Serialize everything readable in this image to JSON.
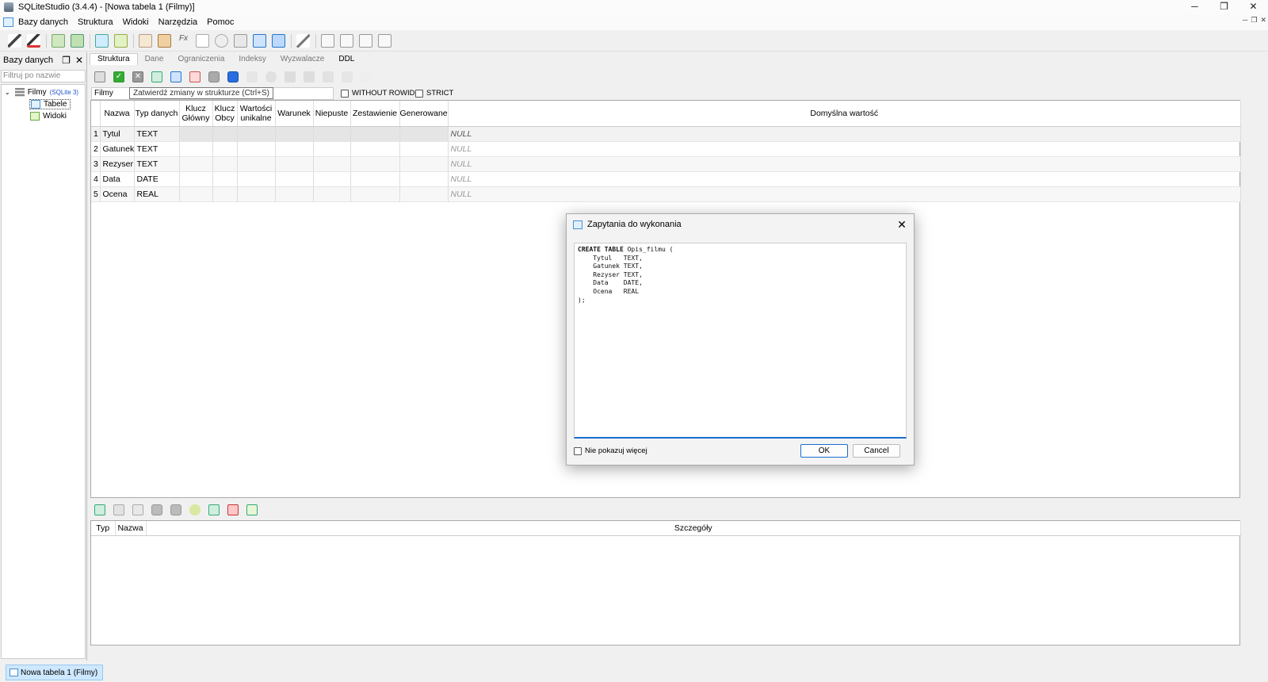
{
  "window": {
    "title": "SQLiteStudio (3.4.4) - [Nowa tabela 1 (Filmy)]",
    "minimize": "─",
    "maximize": "❐",
    "close": "✕"
  },
  "menu": [
    "Bazy danych",
    "Struktura",
    "Widoki",
    "Narzędzia",
    "Pomoc"
  ],
  "db_panel": {
    "title": "Bazy danych",
    "filter_placeholder": "Filtruj po nazwie",
    "db_name": "Filmy",
    "db_tag": "(SQLite 3)",
    "tree_items": [
      "Tabele",
      "Widoki"
    ]
  },
  "editor": {
    "tabs": [
      "Struktura",
      "Dane",
      "Ograniczenia",
      "Indeksy",
      "Wyzwalacze",
      "DDL"
    ],
    "table_name": "Filmy",
    "tooltip": "Zatwierdź zmiany w strukturze (Ctrl+S)",
    "without_rowid": "WITHOUT ROWID",
    "strict": "STRICT",
    "columns": {
      "nazwa": "Nazwa",
      "typ": "Typ danych",
      "pk1": "Klucz",
      "pk2": "Główny",
      "fk1": "Klucz",
      "fk2": "Obcy",
      "uq1": "Wartości",
      "uq2": "unikalne",
      "warunek": "Warunek",
      "niepuste": "Niepuste",
      "zestawienie": "Zestawienie",
      "generowane": "Generowane",
      "domyslna": "Domyślna wartość"
    },
    "rows": [
      {
        "n": "1",
        "name": "Tytul",
        "type": "TEXT",
        "default": "NULL"
      },
      {
        "n": "2",
        "name": "Gatunek",
        "type": "TEXT",
        "default": "NULL"
      },
      {
        "n": "3",
        "name": "Rezyser",
        "type": "TEXT",
        "default": "NULL"
      },
      {
        "n": "4",
        "name": "Data",
        "type": "DATE",
        "default": "NULL"
      },
      {
        "n": "5",
        "name": "Ocena",
        "type": "REAL",
        "default": "NULL"
      }
    ],
    "constraints_columns": {
      "typ": "Typ",
      "nazwa": "Nazwa",
      "szczegoly": "Szczegóły"
    }
  },
  "dialog": {
    "title": "Zapytania do wykonania",
    "sql": {
      "kw": "CREATE TABLE",
      "head": " Opis_filmu (",
      "body": "    Tytul   TEXT,\n    Gatunek TEXT,\n    Rezyser TEXT,\n    Data    DATE,\n    Ocena   REAL\n);"
    },
    "dont_show": "Nie pokazuj więcej",
    "ok": "OK",
    "cancel": "Cancel",
    "close": "✕"
  },
  "taskbar": {
    "tab": "Nowa tabela 1 (Filmy)"
  }
}
